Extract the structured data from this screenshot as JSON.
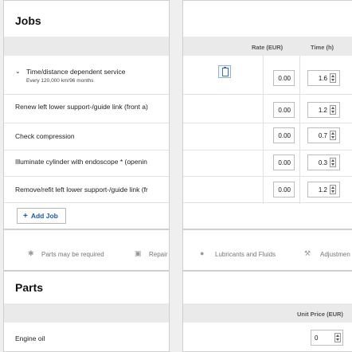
{
  "jobs_section": {
    "title": "Jobs"
  },
  "columns": {
    "rate": "Rate (EUR)",
    "time": "Time (h)"
  },
  "jobs": [
    {
      "label": "Time/distance dependent service",
      "sub": "Every 120,000 km/96 months",
      "rate": "0.00",
      "time": "1.6"
    },
    {
      "label": "Renew left lower support-/guide link (front a)",
      "rate": "0.00",
      "time": "1.2"
    },
    {
      "label": "Check compression",
      "rate": "0.00",
      "time": "0.7"
    },
    {
      "label": "Illuminate cylinder with endoscope * (openin",
      "rate": "0.00",
      "time": "0.3"
    },
    {
      "label": "Remove/refit left lower support-/guide link (fr",
      "rate": "0.00",
      "time": "1.2"
    }
  ],
  "add_job": "Add Job",
  "legend": {
    "parts": "Parts may be required",
    "repair": "Repair",
    "lubricants": "Lubricants and Fluids",
    "adjustment": "Adjustmen"
  },
  "parts_section": {
    "title": "Parts",
    "unit_price": "Unit Price (EUR)"
  },
  "parts": [
    {
      "label": "Engine oil",
      "unit_price": "0"
    }
  ],
  "icons": {
    "chevron": "chevron-down-icon",
    "clipboard": "clipboard-icon",
    "asterisk": "asterisk-icon",
    "repair": "repair-icon",
    "drop": "drop-icon",
    "adjust": "adjustment-icon"
  },
  "colors": {
    "accent": "#1a5aa8",
    "band": "#eaeaea",
    "background": "#efefef"
  }
}
